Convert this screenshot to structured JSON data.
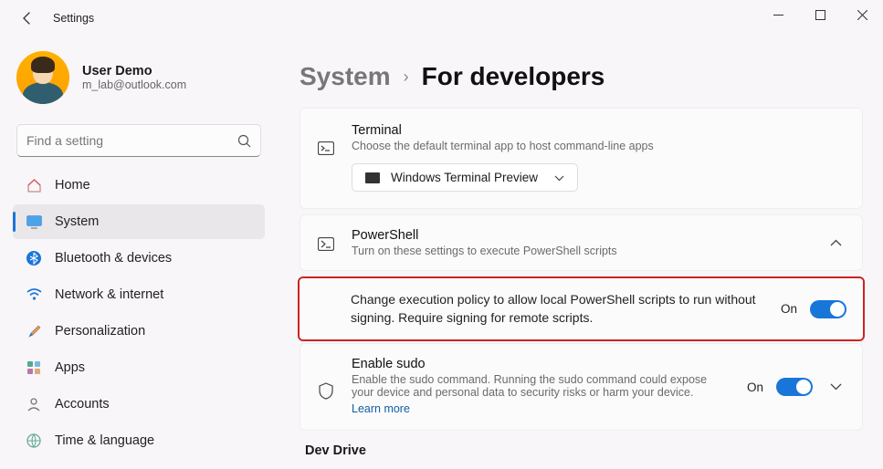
{
  "window": {
    "title": "Settings"
  },
  "profile": {
    "name": "User Demo",
    "email": "m_lab@outlook.com"
  },
  "search": {
    "placeholder": "Find a setting"
  },
  "sidebar": {
    "items": [
      {
        "label": "Home"
      },
      {
        "label": "System"
      },
      {
        "label": "Bluetooth & devices"
      },
      {
        "label": "Network & internet"
      },
      {
        "label": "Personalization"
      },
      {
        "label": "Apps"
      },
      {
        "label": "Accounts"
      },
      {
        "label": "Time & language"
      }
    ]
  },
  "breadcrumb": {
    "root": "System",
    "leaf": "For developers"
  },
  "terminal": {
    "title": "Terminal",
    "subtitle": "Choose the default terminal app to host command-line apps",
    "selected": "Windows Terminal Preview"
  },
  "powershell": {
    "title": "PowerShell",
    "subtitle": "Turn on these settings to execute PowerShell scripts",
    "policy": {
      "desc": "Change execution policy to allow local PowerShell scripts to run without signing. Require signing for remote scripts.",
      "state": "On"
    }
  },
  "sudo": {
    "title": "Enable sudo",
    "desc": "Enable the sudo command. Running the sudo command could expose your device and personal data to security risks or harm your device.",
    "link": "Learn more",
    "state": "On"
  },
  "devdrive": {
    "title": "Dev Drive"
  }
}
